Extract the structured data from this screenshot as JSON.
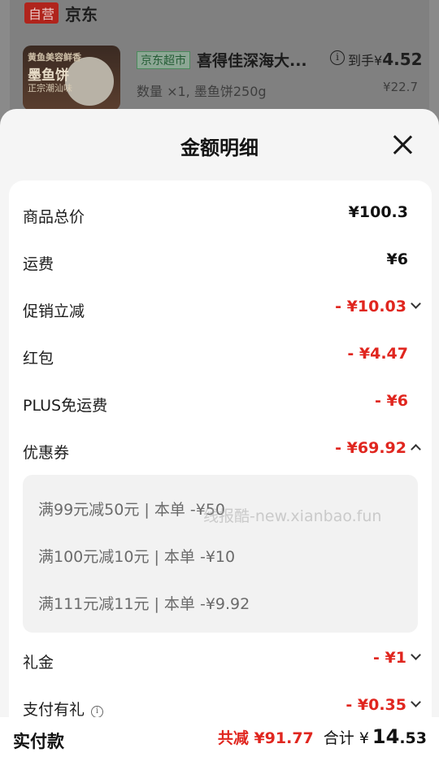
{
  "background": {
    "shop_badge": "自营",
    "shop_name": "京东",
    "thumb_line1": "黄鱼美容鲜香",
    "thumb_line2": "墨鱼饼",
    "thumb_line3": "正宗潮汕味",
    "market_badge": "京东超市",
    "product_name": "喜得佳深海大...",
    "info_symbol": "i",
    "daoshou_label": "到手",
    "daoshou_currency": "¥",
    "daoshou_price": "4.52",
    "product_sub": "数量 ×1, 墨鱼饼250g",
    "orig_price": "¥22.7"
  },
  "sheet": {
    "title": "金额明细",
    "rows": [
      {
        "label": "商品总价",
        "value": "¥100.3"
      },
      {
        "label": "运费",
        "value": "¥6"
      },
      {
        "label": "促销立减",
        "value": "- ¥10.03"
      },
      {
        "label": "红包",
        "value": "- ¥4.47"
      },
      {
        "label": "PLUS免运费",
        "value": "- ¥6"
      },
      {
        "label": "优惠券",
        "value": "- ¥69.92"
      },
      {
        "label": "礼金",
        "value": "- ¥1"
      },
      {
        "label": "支付有礼",
        "value": "- ¥0.35"
      }
    ],
    "coupons": [
      "满99元减50元 | 本单 -¥50",
      "满100元减10元 | 本单 -¥10",
      "满111元减11元 | 本单 -¥9.92"
    ],
    "pay_info_symbol": "i",
    "watermark": "线报酷-new.xianbao.fun"
  },
  "bottom_bar": {
    "pay_label": "实付款",
    "save_text": "共减 ¥91.77",
    "sum_label": "合计 ¥",
    "sum_int": "14",
    "sum_dec": ".53"
  },
  "colors": {
    "accent_red": "#e0261f",
    "badge_red": "#b0241c",
    "market_green": "#4b8a5c"
  }
}
